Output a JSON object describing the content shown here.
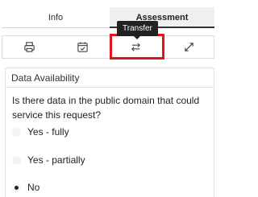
{
  "tabs": [
    {
      "label": "Info",
      "active": false
    },
    {
      "label": "Assessment",
      "active": true
    }
  ],
  "toolbar": {
    "items": [
      {
        "icon": "printer-icon"
      },
      {
        "icon": "calendar-check-icon"
      },
      {
        "icon": "transfer-arrows-icon"
      },
      {
        "icon": "expand-icon"
      }
    ],
    "tooltip": "Transfer",
    "highlight_color": "#e0161b"
  },
  "section": {
    "title": "Data Availability",
    "question": "Is there data in the public domain that could service this request?",
    "options": [
      {
        "label": "Yes - fully",
        "selected": false
      },
      {
        "label": "Yes - partially",
        "selected": false
      },
      {
        "label": "No",
        "selected": true
      }
    ]
  }
}
